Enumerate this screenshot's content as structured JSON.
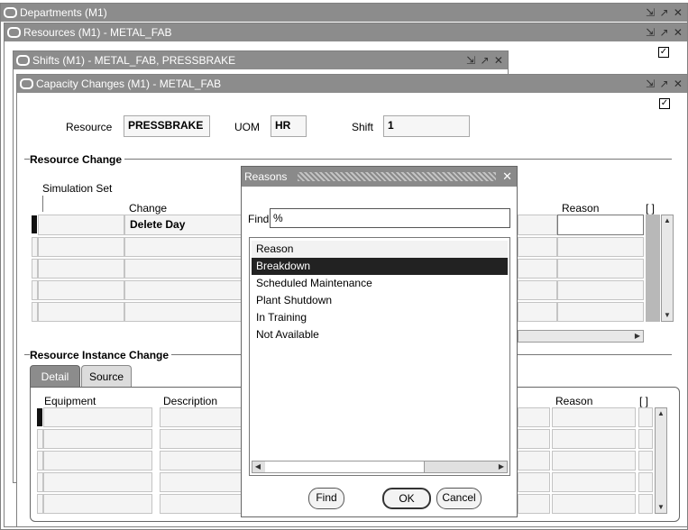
{
  "windows": {
    "departments": {
      "title": "Departments (M1)",
      "controls": "⇲ ↗ ✕"
    },
    "resources": {
      "title": "Resources (M1) - METAL_FAB",
      "controls": "⇲ ↗ ✕"
    },
    "shifts": {
      "title": "Shifts (M1) - METAL_FAB, PRESSBRAKE",
      "controls": "⇲ ↗ ✕"
    },
    "capacity": {
      "title": "Capacity Changes (M1) - METAL_FAB",
      "controls": "⇲ ↗ ✕"
    }
  },
  "header": {
    "resource_label": "Resource",
    "resource_value": "PRESSBRAKE",
    "uom_label": "UOM",
    "uom_value": "HR",
    "shift_label": "Shift",
    "shift_value": "1"
  },
  "resource_change": {
    "section_title": "Resource Change",
    "simulation_set_label": "Simulation Set",
    "change_label": "Change",
    "change_value": "Delete Day",
    "reason_label": "Reason",
    "bracket_label": "[ ]"
  },
  "instance_change": {
    "section_title": "Resource Instance Change",
    "tabs": [
      {
        "label": "Detail"
      },
      {
        "label": "Source"
      }
    ],
    "equipment_label": "Equipment",
    "description_label": "Description",
    "reason_label": "Reason",
    "bracket_label": "[ ]"
  },
  "reasons_dialog": {
    "title": "Reasons",
    "close": "✕",
    "find_label": "Find",
    "find_value": "%",
    "list_header": "Reason",
    "items": [
      {
        "label": "Breakdown",
        "selected": true
      },
      {
        "label": "Scheduled Maintenance",
        "selected": false
      },
      {
        "label": "Plant Shutdown",
        "selected": false
      },
      {
        "label": "In Training",
        "selected": false
      },
      {
        "label": "Not Available",
        "selected": false
      }
    ],
    "find_button": "Find",
    "ok_button": "OK",
    "cancel_button": "Cancel"
  },
  "icons": {
    "window_icon": "window-icon",
    "checkbox": "checkbox-icon",
    "scroll_up": "scroll-up-icon",
    "scroll_down": "scroll-down-icon"
  },
  "colors": {
    "titlebar": "#8c8c8c",
    "selection": "#222222",
    "dialog_title": "#8a8a8a"
  }
}
